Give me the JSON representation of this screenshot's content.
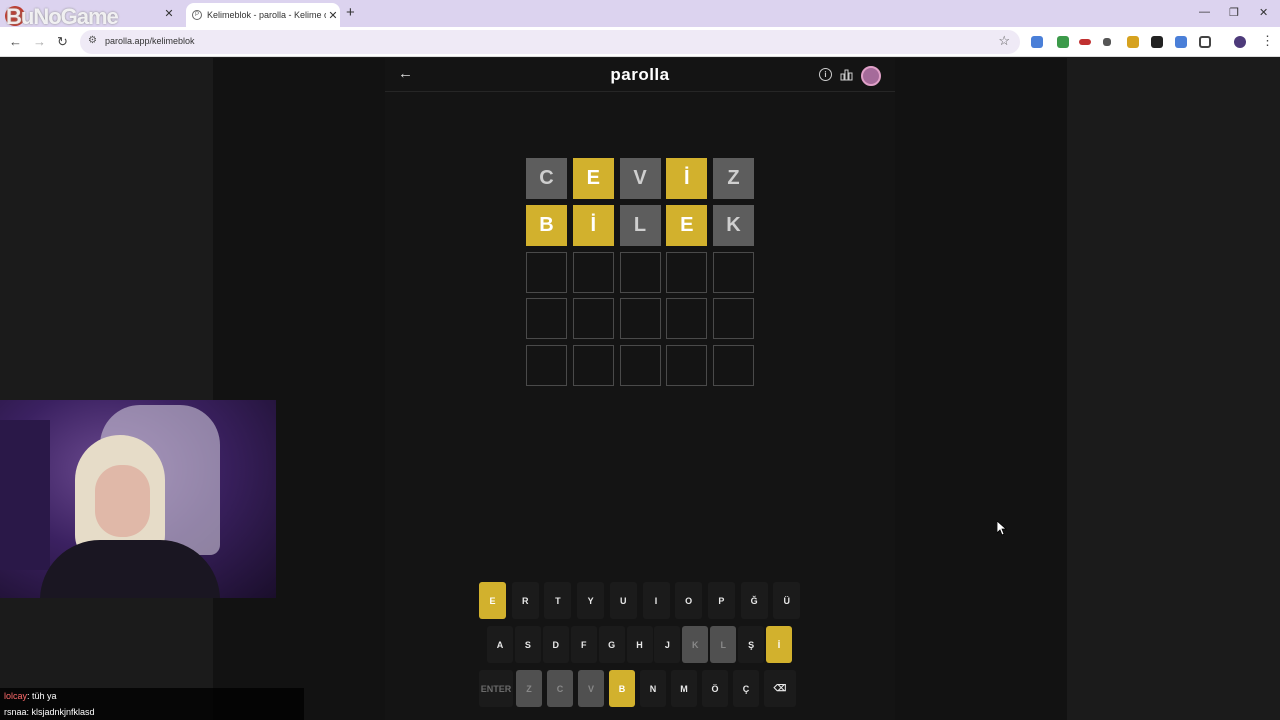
{
  "browser": {
    "watermark": "BuNoGame",
    "tabs": [
      {
        "title": ""
      },
      {
        "title": "Kelimeblok - parolla - Kelime o"
      }
    ],
    "url": "parolla.app/kelimeblok"
  },
  "app": {
    "brand": "parolla",
    "board": {
      "rows": [
        [
          {
            "l": "C",
            "s": "gray"
          },
          {
            "l": "E",
            "s": "yellow"
          },
          {
            "l": "V",
            "s": "gray"
          },
          {
            "l": "İ",
            "s": "yellow"
          },
          {
            "l": "Z",
            "s": "gray"
          }
        ],
        [
          {
            "l": "B",
            "s": "yellow"
          },
          {
            "l": "İ",
            "s": "yellow"
          },
          {
            "l": "L",
            "s": "gray"
          },
          {
            "l": "E",
            "s": "yellow"
          },
          {
            "l": "K",
            "s": "gray"
          }
        ],
        [
          {
            "l": "",
            "s": "empty"
          },
          {
            "l": "",
            "s": "empty"
          },
          {
            "l": "",
            "s": "empty"
          },
          {
            "l": "",
            "s": "empty"
          },
          {
            "l": "",
            "s": "empty"
          }
        ],
        [
          {
            "l": "",
            "s": "empty"
          },
          {
            "l": "",
            "s": "empty"
          },
          {
            "l": "",
            "s": "empty"
          },
          {
            "l": "",
            "s": "empty"
          },
          {
            "l": "",
            "s": "empty"
          }
        ],
        [
          {
            "l": "",
            "s": "empty"
          },
          {
            "l": "",
            "s": "empty"
          },
          {
            "l": "",
            "s": "empty"
          },
          {
            "l": "",
            "s": "empty"
          },
          {
            "l": "",
            "s": "empty"
          }
        ]
      ]
    },
    "keyboard": {
      "row1": [
        {
          "k": "E",
          "s": "y"
        },
        {
          "k": "R",
          "s": ""
        },
        {
          "k": "T",
          "s": ""
        },
        {
          "k": "Y",
          "s": ""
        },
        {
          "k": "U",
          "s": ""
        },
        {
          "k": "I",
          "s": ""
        },
        {
          "k": "O",
          "s": ""
        },
        {
          "k": "P",
          "s": ""
        },
        {
          "k": "Ğ",
          "s": ""
        },
        {
          "k": "Ü",
          "s": ""
        }
      ],
      "row2": [
        {
          "k": "A",
          "s": ""
        },
        {
          "k": "S",
          "s": ""
        },
        {
          "k": "D",
          "s": ""
        },
        {
          "k": "F",
          "s": ""
        },
        {
          "k": "G",
          "s": ""
        },
        {
          "k": "H",
          "s": ""
        },
        {
          "k": "J",
          "s": ""
        },
        {
          "k": "K",
          "s": "g"
        },
        {
          "k": "L",
          "s": "g"
        },
        {
          "k": "Ş",
          "s": ""
        },
        {
          "k": "İ",
          "s": "y"
        }
      ],
      "row3": [
        {
          "k": "ENTER",
          "s": "dim"
        },
        {
          "k": "Z",
          "s": "g"
        },
        {
          "k": "C",
          "s": "g"
        },
        {
          "k": "V",
          "s": "g"
        },
        {
          "k": "B",
          "s": "y"
        },
        {
          "k": "N",
          "s": ""
        },
        {
          "k": "M",
          "s": ""
        },
        {
          "k": "Ö",
          "s": ""
        },
        {
          "k": "Ç",
          "s": ""
        },
        {
          "k": "⌫",
          "s": ""
        }
      ]
    },
    "colors": {
      "yellow": "#d2b12d",
      "gray": "#5d5d5d",
      "background": "#141414"
    }
  },
  "chat": [
    {
      "user": "lolcay",
      "message": ": tüh ya"
    },
    {
      "user": "rsnaa",
      "message": ": klsjadnkjnfklasd"
    }
  ]
}
